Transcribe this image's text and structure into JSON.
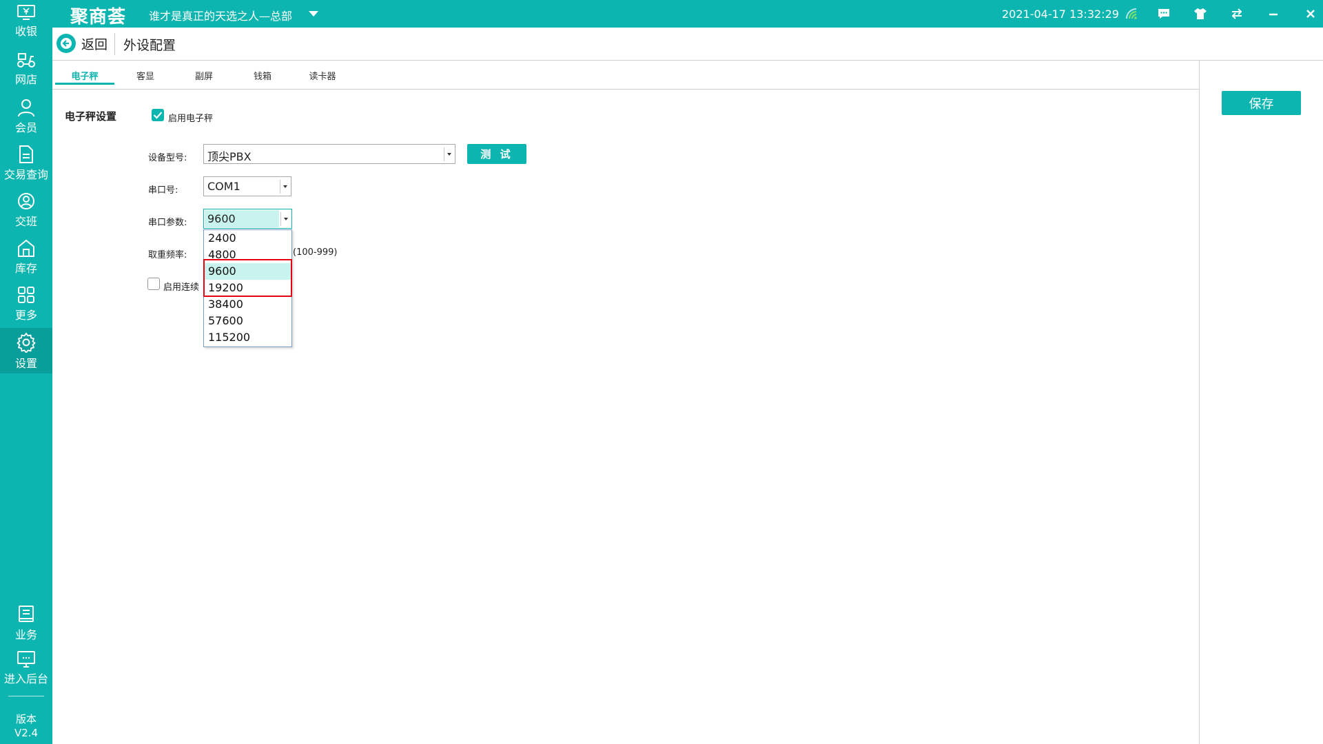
{
  "app": {
    "logo": "聚商荟",
    "store_name": "谁才是真正的天选之人—总部",
    "datetime": "2021-04-17 13:32:29"
  },
  "colors": {
    "accent": "#0db5b1",
    "selected_option_bg": "#c9f3ee",
    "annotation_box": "#e60012"
  },
  "sidebar": {
    "items": [
      {
        "label": "收银",
        "icon": "cash-register-icon"
      },
      {
        "label": "网店",
        "icon": "scooter-icon"
      },
      {
        "label": "会员",
        "icon": "user-icon"
      },
      {
        "label": "交易查询",
        "icon": "document-icon"
      },
      {
        "label": "交班",
        "icon": "shift-icon"
      },
      {
        "label": "库存",
        "icon": "warehouse-icon"
      },
      {
        "label": "更多",
        "icon": "grid-icon"
      },
      {
        "label": "设置",
        "icon": "gear-icon"
      },
      {
        "label": "业务",
        "icon": "book-icon"
      },
      {
        "label": "进入后台",
        "icon": "monitor-icon"
      }
    ],
    "version_label": "版本",
    "version_value": "V2.4"
  },
  "header": {
    "back_label": "返回",
    "title": "外设配置"
  },
  "toolbar": {
    "save_label": "保存"
  },
  "tabs": [
    {
      "label": "电子秤",
      "active": true
    },
    {
      "label": "客显",
      "active": false
    },
    {
      "label": "副屏",
      "active": false
    },
    {
      "label": "钱箱",
      "active": false
    },
    {
      "label": "读卡器",
      "active": false
    }
  ],
  "form": {
    "section_title": "电子秤设置",
    "enable_scale_label": "启用电子秤",
    "enable_scale_checked": true,
    "device_model_label": "设备型号:",
    "device_model_value": "顶尖PBX",
    "test_label": "测 试",
    "port_label": "串口号:",
    "port_value": "COM1",
    "baud_label": "串口参数:",
    "baud_value": "9600",
    "frequency_label": "取重频率:",
    "frequency_hint": "(100-999)",
    "continuous_label": "启用连续",
    "continuous_checked": false
  },
  "baud_dropdown": {
    "options": [
      "2400",
      "4800",
      "9600",
      "19200",
      "38400",
      "57600",
      "115200"
    ],
    "selected": "9600"
  }
}
